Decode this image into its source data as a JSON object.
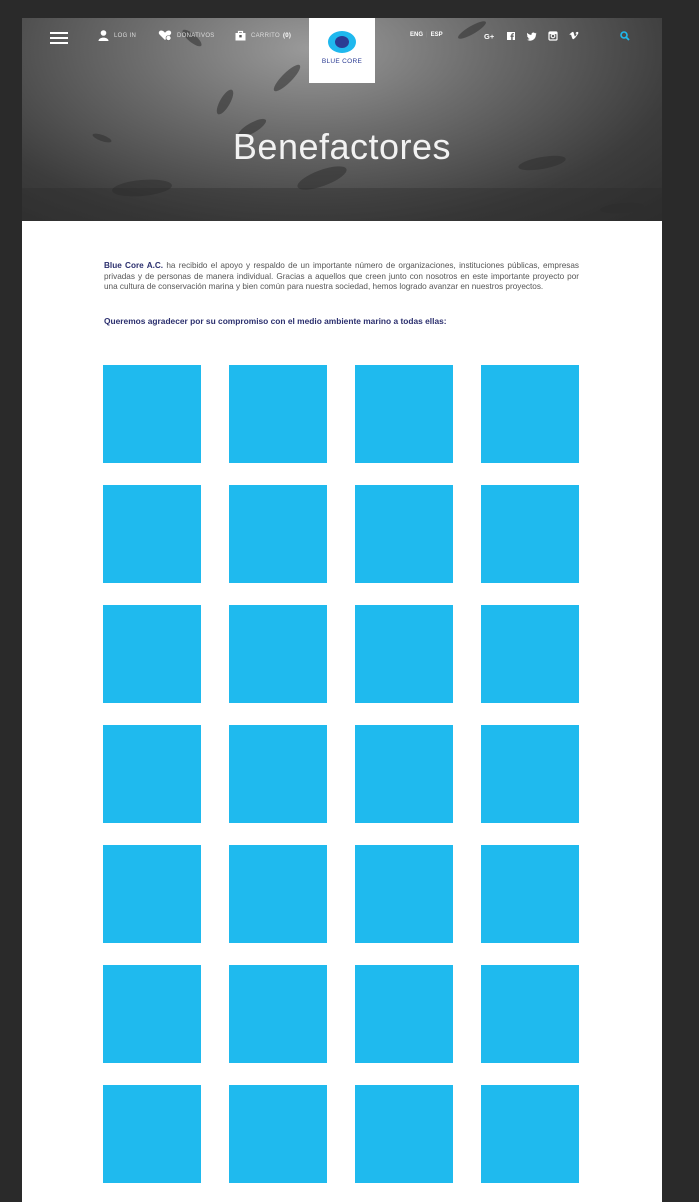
{
  "header": {
    "login_label": "LOG IN",
    "donations_label": "DONATIVOS",
    "cart_label": "CARRITO",
    "cart_count": "(0)",
    "logo_text": "BLUE CORE",
    "lang_eng": "ENG",
    "lang_sep": "|",
    "lang_esp": "ESP",
    "social_icons": [
      "google-plus-icon",
      "facebook-icon",
      "twitter-icon",
      "instagram-icon",
      "vimeo-icon"
    ],
    "search_icon": "search-icon"
  },
  "hero": {
    "title": "Benefactores"
  },
  "intro": {
    "org_name": "Blue Core A.C.",
    "text": " ha recibido el apoyo y respaldo de un importante número de organizaciones, instituciones públicas, empresas privadas y de personas de manera individual. Gracias a aquellos que creen junto con nosotros en este importante proyecto por una cultura de conservación marina  y bien común para nuestra sociedad, hemos logrado avanzar en nuestros proyectos."
  },
  "thanks": "Queremos agradecer por su compromiso con el medio ambiente marino a todas ellas:",
  "benefactors": {
    "count": 28,
    "tile_color": "#1fbaee"
  },
  "colors": {
    "accent": "#1fbaee",
    "navy": "#2b2f6e",
    "search_icon": "#1fbaee"
  }
}
